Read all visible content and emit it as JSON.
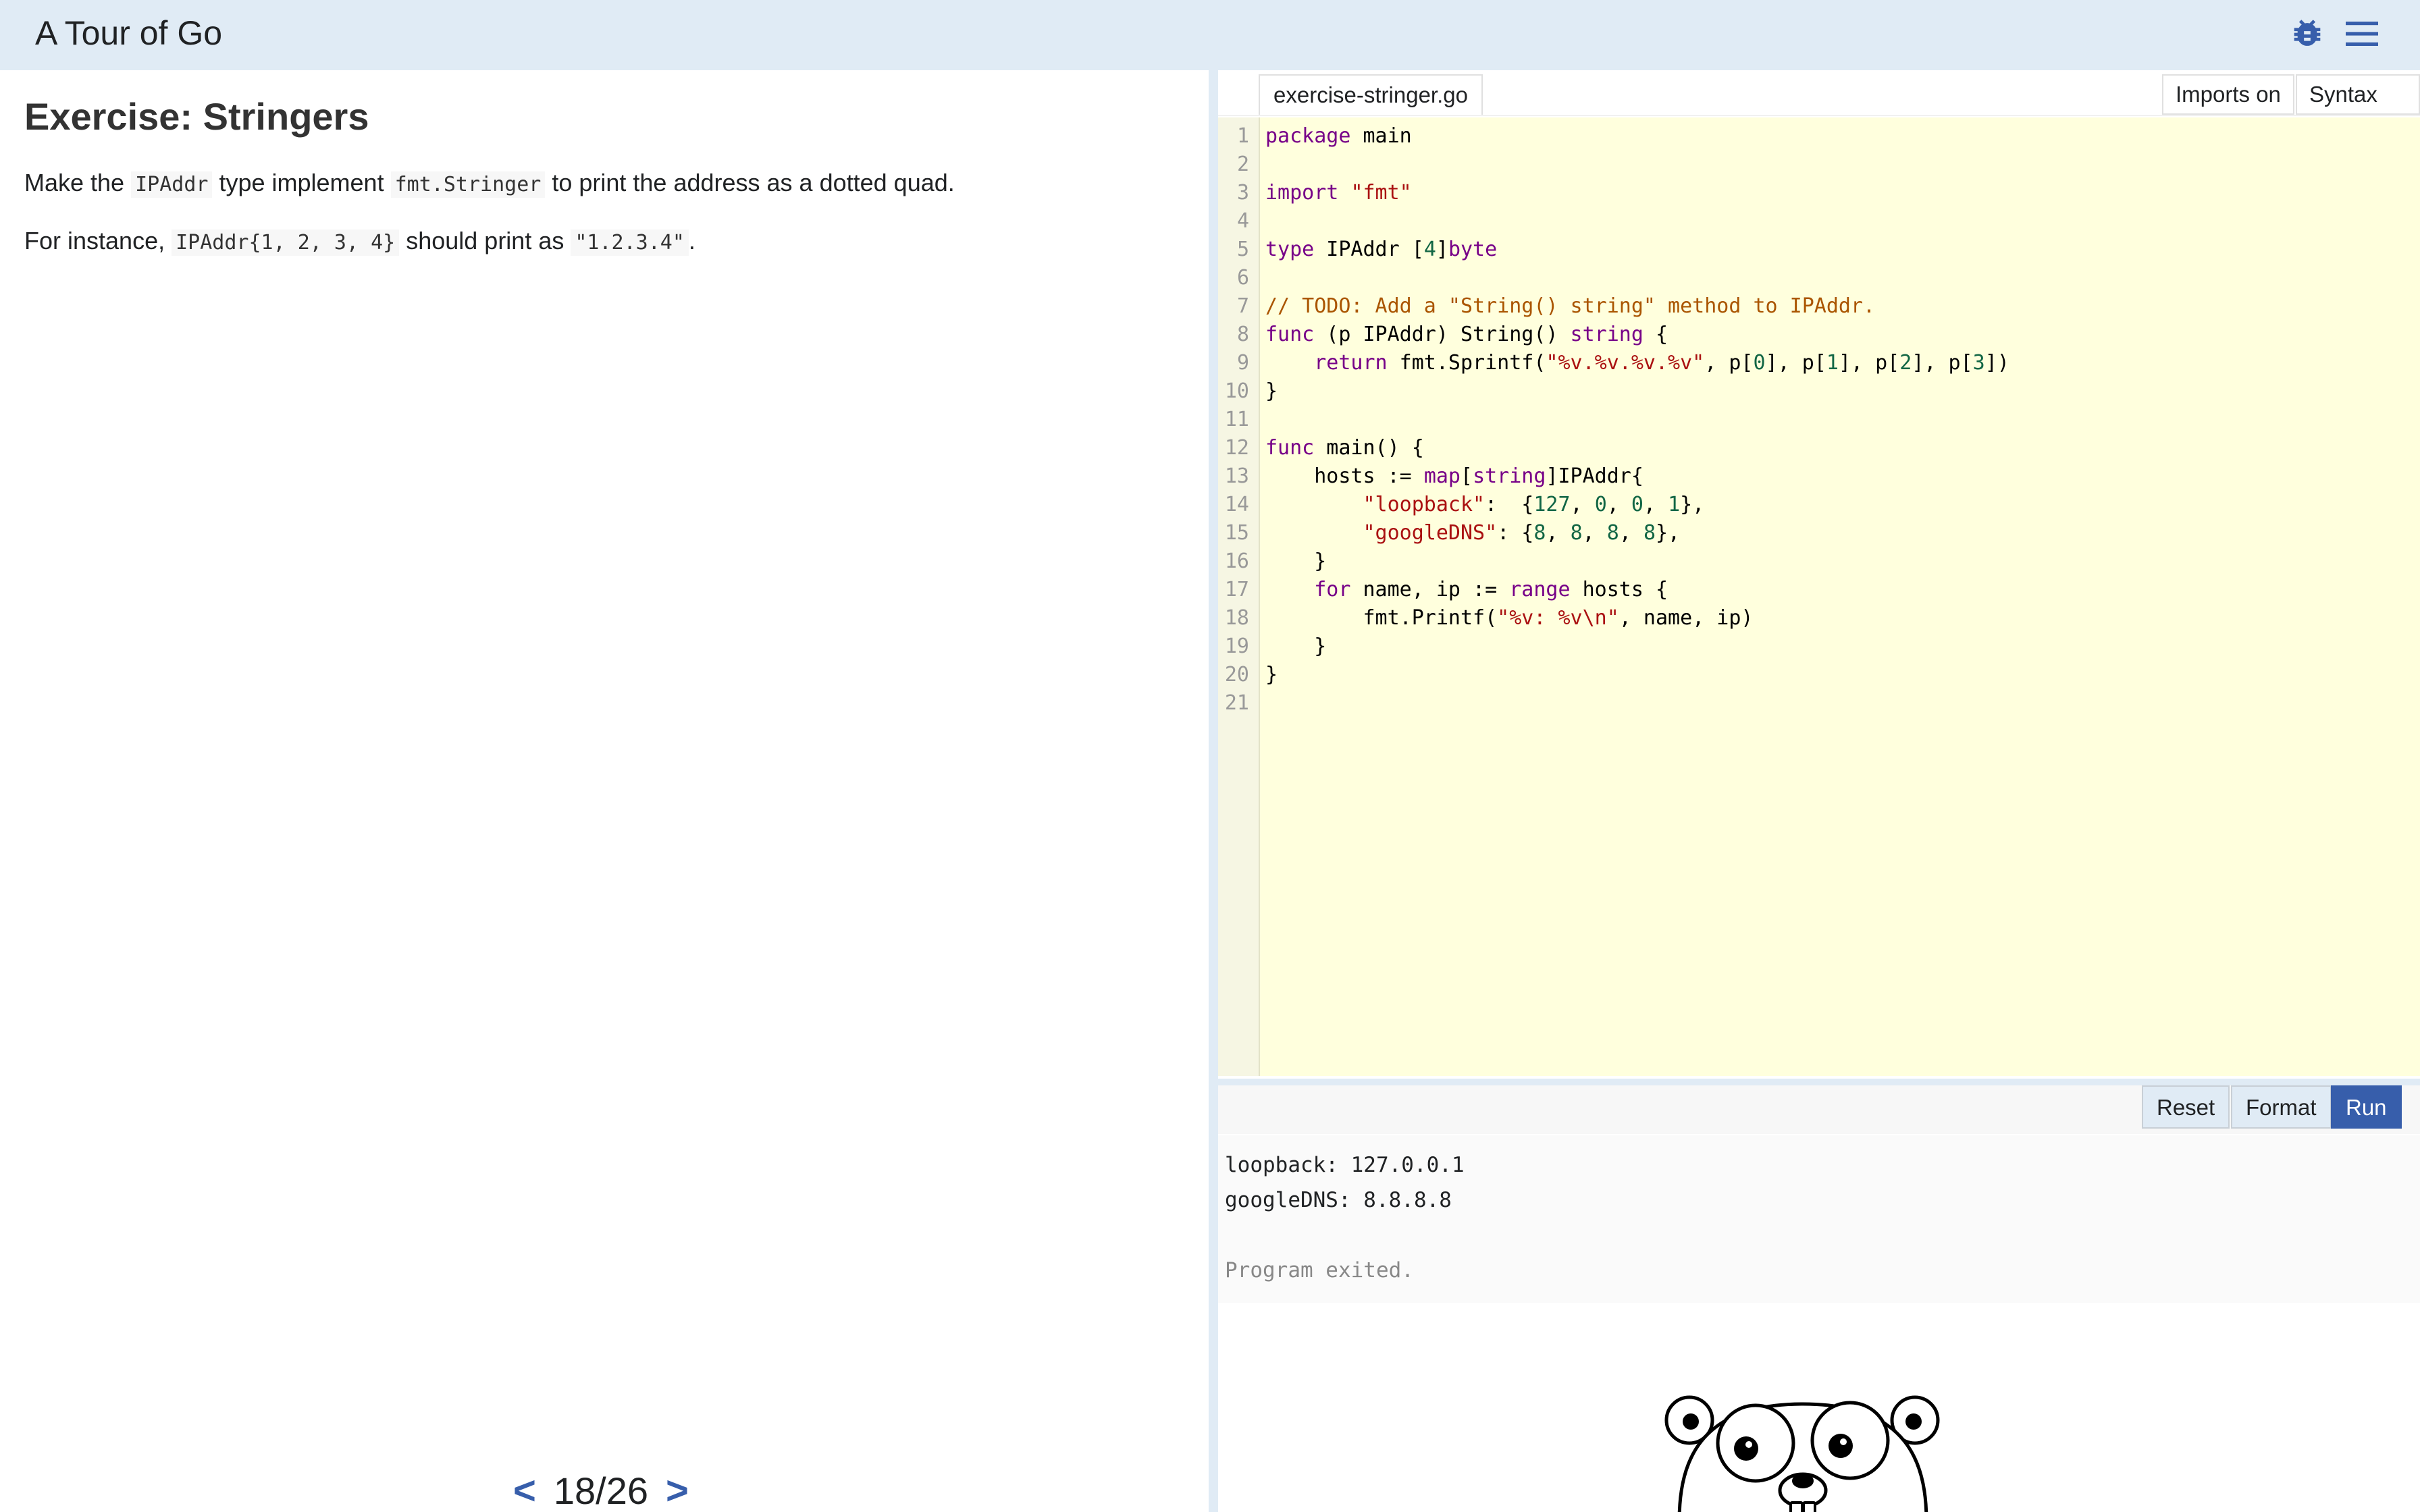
{
  "header": {
    "title": "A Tour of Go",
    "icons": [
      "bug-icon",
      "hamburger-menu-icon"
    ]
  },
  "lesson": {
    "title": "Exercise: Stringers",
    "p1": {
      "pre": "Make the ",
      "code1": "IPAddr",
      "mid": " type implement ",
      "code2": "fmt.Stringer",
      "post": " to print the address as a dotted quad."
    },
    "p2": {
      "pre": "For instance, ",
      "code1": "IPAddr{1, 2, 3, 4}",
      "mid": " should print as ",
      "code2": "\"1.2.3.4\"",
      "post": "."
    }
  },
  "pager": {
    "prev": "<",
    "current": "18/26",
    "next": ">"
  },
  "editor": {
    "filename": "exercise-stringer.go",
    "imports_label": "Imports on",
    "syntax_label": "Syntax on",
    "line_numbers": [
      "1",
      "2",
      "3",
      "4",
      "5",
      "6",
      "7",
      "8",
      "9",
      "10",
      "11",
      "12",
      "13",
      "14",
      "15",
      "16",
      "17",
      "18",
      "19",
      "20",
      "21"
    ],
    "lines": [
      [
        {
          "t": "package",
          "c": "kw"
        },
        {
          "t": " main",
          "c": ""
        }
      ],
      [],
      [
        {
          "t": "import",
          "c": "kw"
        },
        {
          "t": " ",
          "c": ""
        },
        {
          "t": "\"fmt\"",
          "c": "str"
        }
      ],
      [],
      [
        {
          "t": "type",
          "c": "kw"
        },
        {
          "t": " IPAddr [",
          "c": ""
        },
        {
          "t": "4",
          "c": "num"
        },
        {
          "t": "]",
          "c": ""
        },
        {
          "t": "byte",
          "c": "ty"
        }
      ],
      [],
      [
        {
          "t": "// TODO: Add a \"String() string\" method to IPAddr.",
          "c": "cm"
        }
      ],
      [
        {
          "t": "func",
          "c": "kw"
        },
        {
          "t": " (p IPAddr) String() ",
          "c": ""
        },
        {
          "t": "string",
          "c": "ty"
        },
        {
          "t": " {",
          "c": ""
        }
      ],
      [
        {
          "t": "    ",
          "c": ""
        },
        {
          "t": "return",
          "c": "kw"
        },
        {
          "t": " fmt.Sprintf(",
          "c": ""
        },
        {
          "t": "\"%v.%v.%v.%v\"",
          "c": "str"
        },
        {
          "t": ", p[",
          "c": ""
        },
        {
          "t": "0",
          "c": "num"
        },
        {
          "t": "], p[",
          "c": ""
        },
        {
          "t": "1",
          "c": "num"
        },
        {
          "t": "], p[",
          "c": ""
        },
        {
          "t": "2",
          "c": "num"
        },
        {
          "t": "], p[",
          "c": ""
        },
        {
          "t": "3",
          "c": "num"
        },
        {
          "t": "])",
          "c": ""
        }
      ],
      [
        {
          "t": "}",
          "c": ""
        }
      ],
      [],
      [
        {
          "t": "func",
          "c": "kw"
        },
        {
          "t": " main() {",
          "c": ""
        }
      ],
      [
        {
          "t": "    hosts := ",
          "c": ""
        },
        {
          "t": "map",
          "c": "kw"
        },
        {
          "t": "[",
          "c": ""
        },
        {
          "t": "string",
          "c": "ty"
        },
        {
          "t": "]IPAddr{",
          "c": ""
        }
      ],
      [
        {
          "t": "        ",
          "c": ""
        },
        {
          "t": "\"loopback\"",
          "c": "str"
        },
        {
          "t": ":  {",
          "c": ""
        },
        {
          "t": "127",
          "c": "num"
        },
        {
          "t": ", ",
          "c": ""
        },
        {
          "t": "0",
          "c": "num"
        },
        {
          "t": ", ",
          "c": ""
        },
        {
          "t": "0",
          "c": "num"
        },
        {
          "t": ", ",
          "c": ""
        },
        {
          "t": "1",
          "c": "num"
        },
        {
          "t": "},",
          "c": ""
        }
      ],
      [
        {
          "t": "        ",
          "c": ""
        },
        {
          "t": "\"googleDNS\"",
          "c": "str"
        },
        {
          "t": ": {",
          "c": ""
        },
        {
          "t": "8",
          "c": "num"
        },
        {
          "t": ", ",
          "c": ""
        },
        {
          "t": "8",
          "c": "num"
        },
        {
          "t": ", ",
          "c": ""
        },
        {
          "t": "8",
          "c": "num"
        },
        {
          "t": ", ",
          "c": ""
        },
        {
          "t": "8",
          "c": "num"
        },
        {
          "t": "},",
          "c": ""
        }
      ],
      [
        {
          "t": "    }",
          "c": ""
        }
      ],
      [
        {
          "t": "    ",
          "c": ""
        },
        {
          "t": "for",
          "c": "kw"
        },
        {
          "t": " name, ip := ",
          "c": ""
        },
        {
          "t": "range",
          "c": "kw"
        },
        {
          "t": " hosts {",
          "c": ""
        }
      ],
      [
        {
          "t": "        fmt.Printf(",
          "c": ""
        },
        {
          "t": "\"%v: %v\\n\"",
          "c": "str"
        },
        {
          "t": ", name, ip)",
          "c": ""
        }
      ],
      [
        {
          "t": "    }",
          "c": ""
        }
      ],
      [
        {
          "t": "}",
          "c": ""
        }
      ],
      []
    ]
  },
  "actions": {
    "reset": "Reset",
    "format": "Format",
    "run": "Run"
  },
  "output": {
    "lines": [
      "loopback: 127.0.0.1",
      "googleDNS: 8.8.8.8"
    ],
    "exit": "Program exited."
  },
  "colors": {
    "accent": "#375eab",
    "header_bg": "#e0ebf5",
    "editor_bg": "#ffffdd"
  }
}
